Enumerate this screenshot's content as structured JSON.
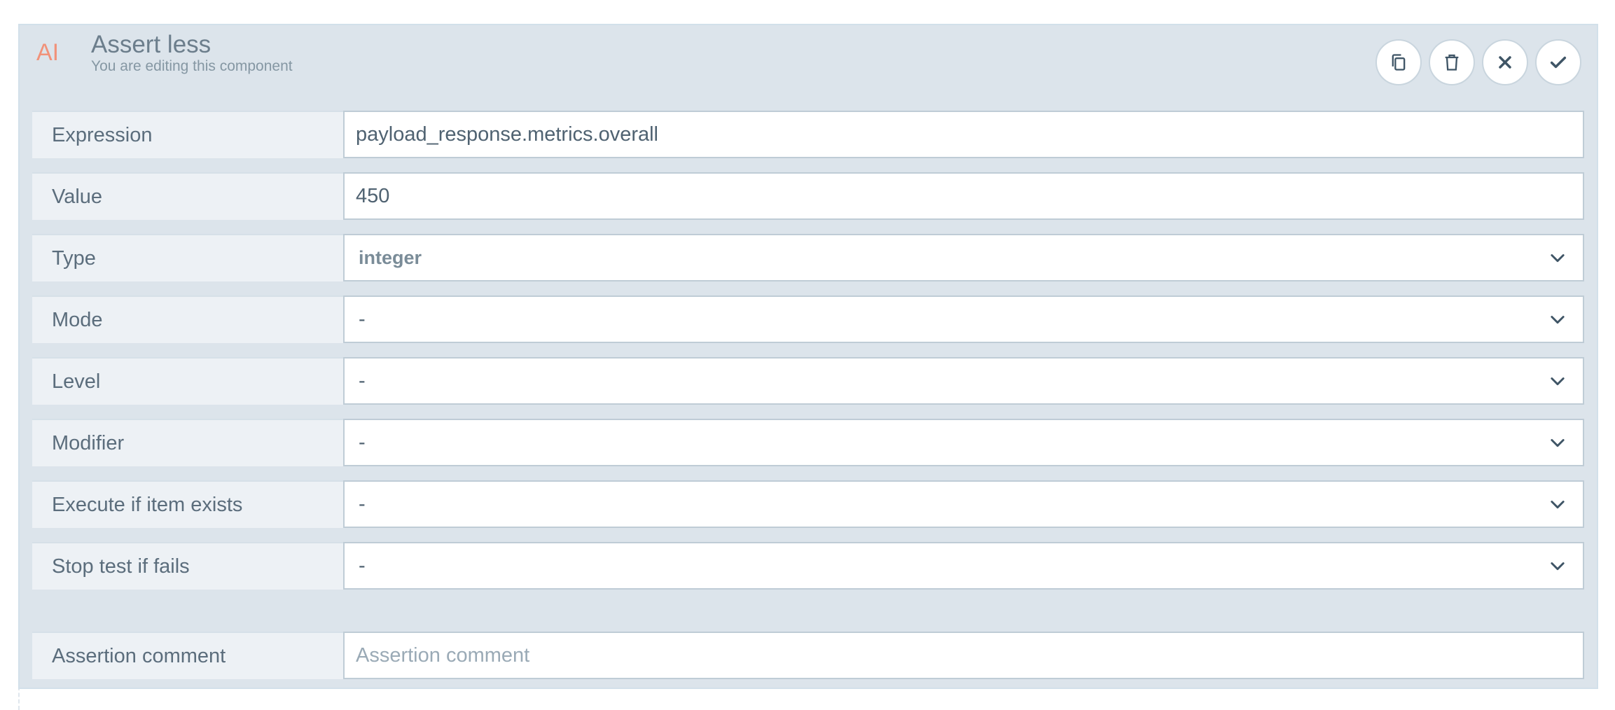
{
  "header": {
    "badge": "AI",
    "title": "Assert less",
    "subtitle": "You are editing this component",
    "actions": [
      {
        "name": "copy",
        "icon": "copy-icon"
      },
      {
        "name": "delete",
        "icon": "trash-icon"
      },
      {
        "name": "cancel",
        "icon": "close-icon"
      },
      {
        "name": "confirm",
        "icon": "check-icon"
      }
    ]
  },
  "fields": {
    "expression": {
      "label": "Expression",
      "value": "payload_response.metrics.overall"
    },
    "value": {
      "label": "Value",
      "value": "450"
    },
    "type": {
      "label": "Type",
      "selected": "integer"
    },
    "mode": {
      "label": "Mode",
      "selected": "-"
    },
    "level": {
      "label": "Level",
      "selected": "-"
    },
    "modifier": {
      "label": "Modifier",
      "selected": "-"
    },
    "execute_if_exists": {
      "label": "Execute if item exists",
      "selected": "-"
    },
    "stop_if_fails": {
      "label": "Stop test if fails",
      "selected": "-"
    },
    "comment": {
      "label": "Assertion comment",
      "placeholder": "Assertion comment"
    }
  },
  "colors": {
    "accent": "#f1927a",
    "panel": "#dce4eb",
    "label_bg": "#edf1f5",
    "text": "#5b6d7c"
  }
}
